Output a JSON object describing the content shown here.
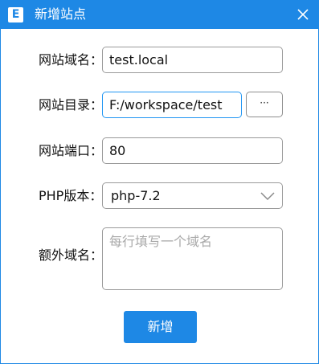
{
  "window": {
    "title": "新增站点",
    "app_icon_letter": "E"
  },
  "form": {
    "domain": {
      "label": "网站域名：",
      "value": "test.local"
    },
    "directory": {
      "label": "网站目录：",
      "value": "F:/workspace/test",
      "browse_label": "···"
    },
    "port": {
      "label": "网站端口：",
      "value": "80"
    },
    "php": {
      "label": "PHP版本：",
      "selected": "php-7.2"
    },
    "extra_domains": {
      "label": "额外域名：",
      "placeholder": "每行填写一个域名"
    }
  },
  "submit_label": "新增",
  "colors": {
    "accent": "#1e88e5",
    "focus_border": "#2196f3"
  }
}
